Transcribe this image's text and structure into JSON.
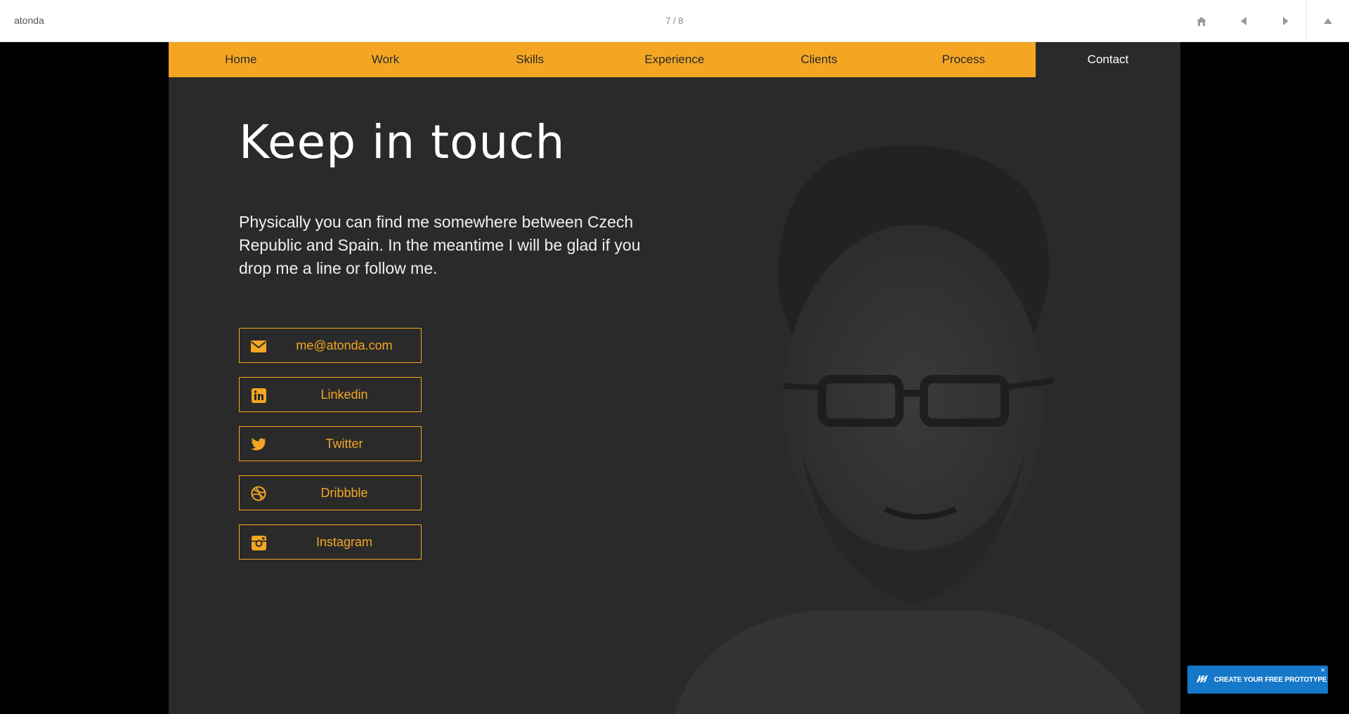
{
  "topbar": {
    "title": "atonda",
    "pager": "7 / 8",
    "icons": [
      "home-icon",
      "prev-icon",
      "next-icon",
      "collapse-icon"
    ]
  },
  "nav": {
    "items": [
      "Home",
      "Work",
      "Skills",
      "Experience",
      "Clients",
      "Process",
      "Contact"
    ],
    "active": "Contact"
  },
  "content": {
    "heading": "Keep in touch",
    "intro": "Physically you can find me somewhere between Czech Republic and Spain. In the meantime I will be glad if you drop me a line or follow me.",
    "links": [
      {
        "label": "me@atonda.com",
        "icon": "envelope-icon"
      },
      {
        "label": "Linkedin",
        "icon": "linkedin-icon"
      },
      {
        "label": "Twitter",
        "icon": "twitter-icon"
      },
      {
        "label": "Dribbble",
        "icon": "dribbble-icon"
      },
      {
        "label": "Instagram",
        "icon": "instagram-icon"
      }
    ]
  },
  "promo": {
    "label": "CREATE YOUR FREE PROTOTYPE",
    "close": "×"
  },
  "colors": {
    "accent": "#f4a623",
    "stage": "#2a2a2a",
    "promo": "#1578c8"
  }
}
